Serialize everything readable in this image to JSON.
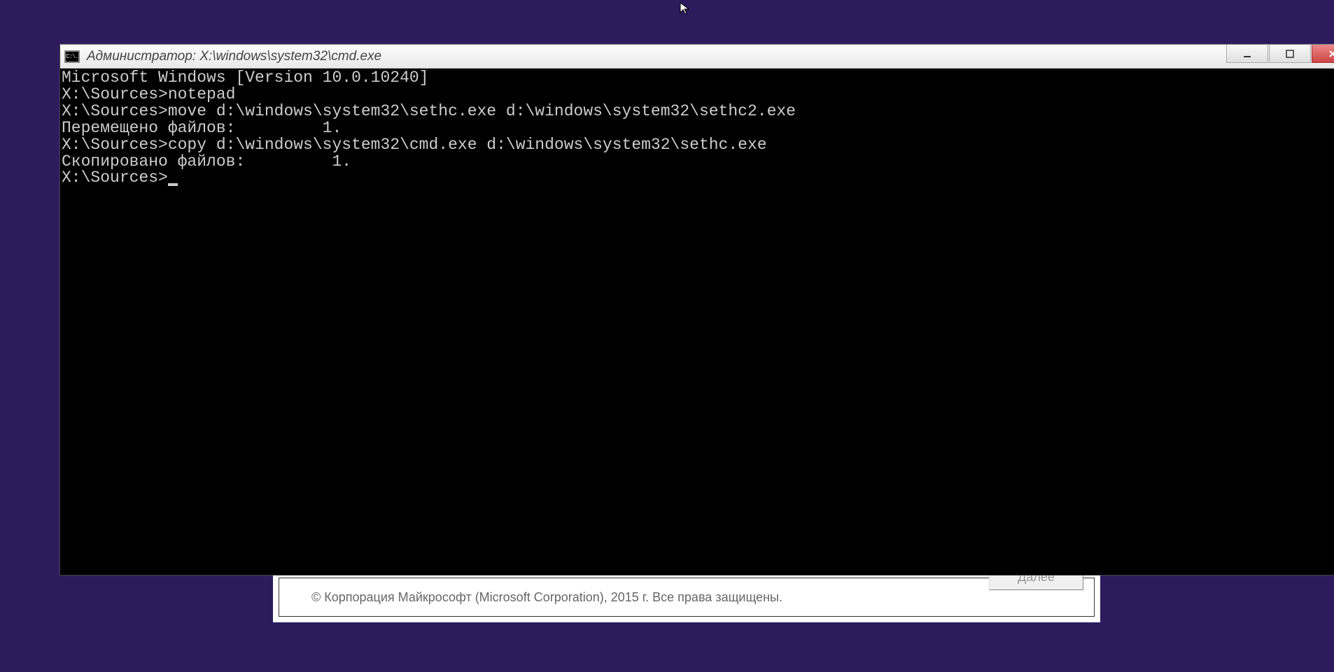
{
  "window": {
    "title": "Администратор: X:\\windows\\system32\\cmd.exe",
    "icon_text": "C:\\."
  },
  "dialog": {
    "copyright": "© Корпорация Майкрософт (Microsoft Corporation), 2015 г. Все права защищены.",
    "button_label": "Далее"
  },
  "terminal": {
    "lines": [
      "Microsoft Windows [Version 10.0.10240]",
      "",
      "X:\\Sources>notepad",
      "",
      "X:\\Sources>move d:\\windows\\system32\\sethc.exe d:\\windows\\system32\\sethc2.exe",
      "Перемещено файлов:         1.",
      "",
      "X:\\Sources>copy d:\\windows\\system32\\cmd.exe d:\\windows\\system32\\sethc.exe",
      "Скопировано файлов:         1.",
      ""
    ],
    "prompt": "X:\\Sources>"
  }
}
